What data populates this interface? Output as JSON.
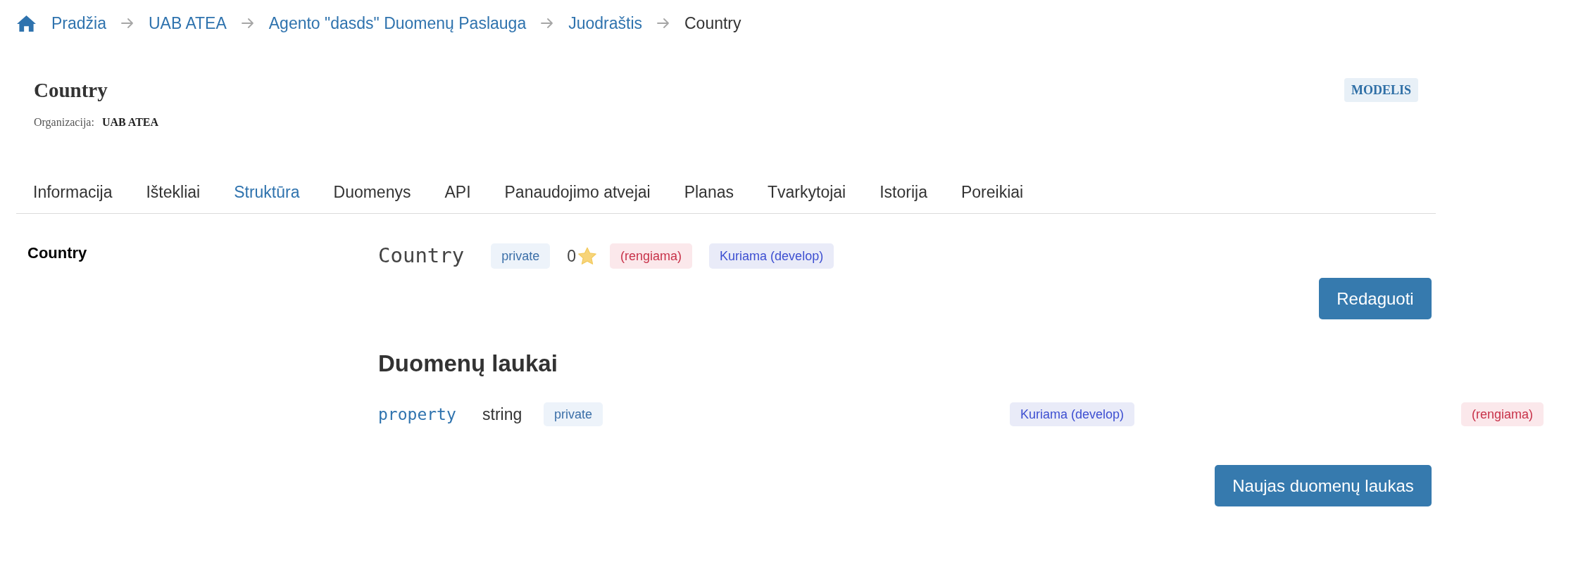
{
  "breadcrumb": [
    {
      "kind": "home",
      "label": "Pradžia"
    },
    {
      "kind": "link",
      "label": "UAB ATEA"
    },
    {
      "kind": "link",
      "label": "Agento \"dasds\" Duomenų Paslauga"
    },
    {
      "kind": "link",
      "label": "Juodraštis"
    },
    {
      "kind": "current",
      "label": "Country"
    }
  ],
  "header": {
    "title": "Country",
    "organization_label": "Organizacija:",
    "organization": "UAB ATEA",
    "type_badge": "MODELIS"
  },
  "tabs": [
    {
      "label": "Informacija",
      "selected": false
    },
    {
      "label": "Ištekliai",
      "selected": false
    },
    {
      "label": "Struktūra",
      "selected": true
    },
    {
      "label": "Duomenys",
      "selected": false
    },
    {
      "label": "API",
      "selected": false
    },
    {
      "label": "Panaudojimo atvejai",
      "selected": false
    },
    {
      "label": "Planas",
      "selected": false
    },
    {
      "label": "Tvarkytojai",
      "selected": false
    },
    {
      "label": "Istorija",
      "selected": false
    },
    {
      "label": "Poreikiai",
      "selected": false
    }
  ],
  "sidebar": {
    "items": [
      {
        "label": "Country"
      }
    ]
  },
  "model": {
    "name": "Country",
    "tags": [
      {
        "kind": "access",
        "text": "private"
      },
      {
        "kind": "stars",
        "text": "0"
      },
      {
        "kind": "status",
        "text": "(rengiama)"
      },
      {
        "kind": "stage",
        "text": "Kuriama (develop)"
      }
    ],
    "edit_button": "Redaguoti"
  },
  "fields_section": {
    "title": "Duomenų laukai",
    "rows": [
      {
        "name": "property",
        "type": "string",
        "access": "private",
        "stage": "Kuriama (develop)",
        "status": "(rengiama)"
      }
    ],
    "new_button": "Naujas duomenų laukas"
  }
}
